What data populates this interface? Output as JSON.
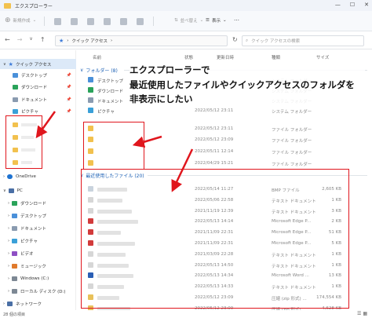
{
  "window": {
    "title": "エクスプローラー",
    "controls": [
      "—",
      "☐",
      "✕"
    ]
  },
  "toolbar": {
    "new_label": "新規作成",
    "sort_label": "並べ替え",
    "view_label": "表示",
    "more_label": "…"
  },
  "address": {
    "back": "←",
    "forward": "→",
    "up_arrow": "∨",
    "up": "↑",
    "path": "クイック アクセス",
    "refresh": "↻",
    "search_placeholder": "クイック アクセスの検索"
  },
  "sidebar": {
    "items": [
      {
        "label": "クイック アクセス",
        "icon": "star-icon"
      },
      {
        "label": "デスクトップ",
        "icon": "desktop-icon"
      },
      {
        "label": "ダウンロード",
        "icon": "download-icon"
      },
      {
        "label": "ドキュメント",
        "icon": "document-icon"
      },
      {
        "label": "ピクチャ",
        "icon": "picture-icon"
      },
      {
        "label": "",
        "icon": "folder-icon"
      },
      {
        "label": "",
        "icon": "folder-icon"
      },
      {
        "label": "",
        "icon": "folder-icon"
      },
      {
        "label": "",
        "icon": "folder-icon"
      },
      {
        "label": "OneDrive",
        "icon": "cloud-icon"
      },
      {
        "label": "PC",
        "icon": "pc-icon"
      },
      {
        "label": "ダウンロード",
        "icon": "download-icon"
      },
      {
        "label": "デスクトップ",
        "icon": "desktop-icon"
      },
      {
        "label": "ドキュメント",
        "icon": "document-icon"
      },
      {
        "label": "ピクチャ",
        "icon": "picture-icon"
      },
      {
        "label": "ビデオ",
        "icon": "video-icon"
      },
      {
        "label": "ミュージック",
        "icon": "music-icon"
      },
      {
        "label": "Windows (C:)",
        "icon": "drive-icon"
      },
      {
        "label": "ローカル ディスク (D:)",
        "icon": "drive-icon"
      },
      {
        "label": "ネットワーク",
        "icon": "network-icon"
      }
    ]
  },
  "columns": {
    "name": "名前",
    "status": "状態",
    "date": "更新日時",
    "type": "種類",
    "size": "サイズ"
  },
  "folders_group": {
    "label": "フォルダー (8)",
    "rows": [
      {
        "name": "デスクトップ",
        "date": "",
        "type": "システム フォルダー"
      },
      {
        "name": "ダウンロード",
        "date": "",
        "type": "システム フォルダー"
      },
      {
        "name": "ドキュメント",
        "date": "",
        "type": "システム フォルダー"
      },
      {
        "name": "ピクチャ",
        "date": "2022/05/12 23:11",
        "type": "システム フォルダー"
      },
      {
        "name": "",
        "date": "2022/05/12 23:11",
        "type": "ファイル フォルダー"
      },
      {
        "name": "",
        "date": "2022/05/12 23:09",
        "type": "ファイル フォルダー"
      },
      {
        "name": "",
        "date": "2022/05/11 12:14",
        "type": "ファイル フォルダー"
      },
      {
        "name": "",
        "date": "2022/04/29 15:21",
        "type": "ファイル フォルダー"
      }
    ]
  },
  "recent_group": {
    "label": "最近使用したファイル (20)",
    "rows": [
      {
        "date": "2022/05/14 11:27",
        "type": "BMP ファイル",
        "size": "2,605 KB"
      },
      {
        "date": "2022/05/06 22:58",
        "type": "テキスト ドキュメント",
        "size": "1 KB"
      },
      {
        "date": "2021/11/19 12:39",
        "type": "テキスト ドキュメント",
        "size": "3 KB"
      },
      {
        "date": "2022/05/13 14:14",
        "type": "Microsoft Edge P...",
        "size": "2 KB"
      },
      {
        "date": "2021/11/09 22:31",
        "type": "Microsoft Edge P...",
        "size": "51 KB"
      },
      {
        "date": "2021/11/09 22:31",
        "type": "Microsoft Edge P...",
        "size": "5 KB"
      },
      {
        "date": "2021/03/09 22:28",
        "type": "テキスト ドキュメント",
        "size": "1 KB"
      },
      {
        "date": "2022/05/13 14:50",
        "type": "テキスト ドキュメント",
        "size": "1 KB"
      },
      {
        "date": "2022/05/13 14:34",
        "type": "Microsoft Word ...",
        "size": "13 KB"
      },
      {
        "date": "2022/05/13 14:33",
        "type": "テキスト ドキュメント",
        "size": "1 KB"
      },
      {
        "date": "2022/05/12 23:09",
        "type": "圧縮 (zip 形式) ...",
        "size": "174,554 KB"
      },
      {
        "date": "2022/05/12 23:09",
        "type": "圧縮 (zip 形式) ...",
        "size": "4,628 KB"
      }
    ]
  },
  "annotation": {
    "line1": "エクスプローラーで",
    "line2": "最近使用したファイルやクイックアクセスのフォルダを",
    "line3": "非表示にしたい"
  },
  "status": {
    "count": "28 個の項目"
  },
  "colors": {
    "accent": "#1a5fb4",
    "highlight": "#e0161d",
    "folder": "#f2c14e"
  }
}
